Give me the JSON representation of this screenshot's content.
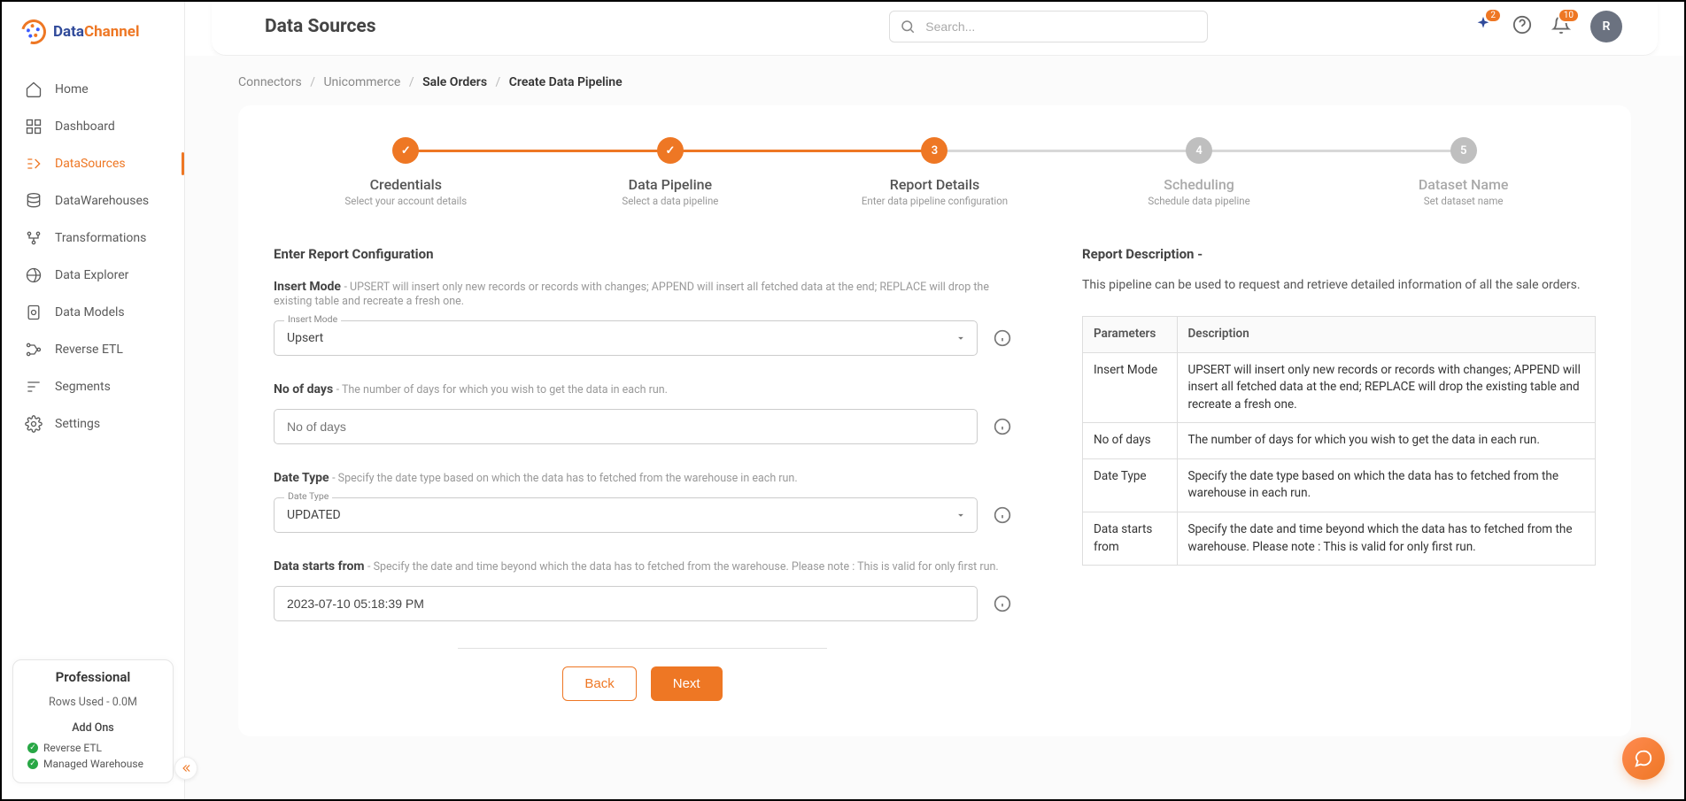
{
  "brand": {
    "part1": "Data",
    "part2": "Channel"
  },
  "sidebar": {
    "items": [
      {
        "label": "Home"
      },
      {
        "label": "Dashboard"
      },
      {
        "label": "DataSources"
      },
      {
        "label": "DataWarehouses"
      },
      {
        "label": "Transformations"
      },
      {
        "label": "Data Explorer"
      },
      {
        "label": "Data Models"
      },
      {
        "label": "Reverse ETL"
      },
      {
        "label": "Segments"
      },
      {
        "label": "Settings"
      }
    ],
    "plan": {
      "name": "Professional",
      "rows": "Rows Used - 0.0M",
      "addons_title": "Add Ons",
      "addons": [
        "Reverse ETL",
        "Managed Warehouse"
      ]
    }
  },
  "topbar": {
    "title": "Data Sources",
    "search_placeholder": "Search...",
    "spark_badge": "2",
    "bell_badge": "10",
    "avatar_initial": "R"
  },
  "breadcrumb": {
    "items": [
      "Connectors",
      "Unicommerce",
      "Sale Orders",
      "Create Data Pipeline"
    ]
  },
  "stepper": [
    {
      "title": "Credentials",
      "sub": "Select your account details",
      "state": "done",
      "mark": "✓"
    },
    {
      "title": "Data Pipeline",
      "sub": "Select a data pipeline",
      "state": "done",
      "mark": "✓"
    },
    {
      "title": "Report Details",
      "sub": "Enter data pipeline configuration",
      "state": "active",
      "mark": "3"
    },
    {
      "title": "Scheduling",
      "sub": "Schedule data pipeline",
      "state": "pending",
      "mark": "4"
    },
    {
      "title": "Dataset Name",
      "sub": "Set dataset name",
      "state": "pending",
      "mark": "5"
    }
  ],
  "form": {
    "section_title": "Enter Report Configuration",
    "fields": {
      "insert_mode": {
        "label": "Insert Mode",
        "help": "- UPSERT will insert only new records or records with changes; APPEND will insert all fetched data at the end; REPLACE will drop the existing table and recreate a fresh one.",
        "float": "Insert Mode",
        "value": "Upsert"
      },
      "no_of_days": {
        "label": "No of days",
        "help": "- The number of days for which you wish to get the data in each run.",
        "placeholder": "No of days",
        "value": ""
      },
      "date_type": {
        "label": "Date Type",
        "help": "- Specify the date type based on which the data has to fetched from the warehouse in each run.",
        "float": "Date Type",
        "value": "UPDATED"
      },
      "data_starts": {
        "label": "Data starts from",
        "help": "- Specify the date and time beyond which the data has to fetched from the warehouse. Please note : This is valid for only first run.",
        "value": "2023-07-10 05:18:39 PM"
      }
    }
  },
  "description": {
    "title": "Report Description -",
    "text": "This pipeline can be used to request and retrieve detailed information of all the sale orders.",
    "table": {
      "headers": [
        "Parameters",
        "Description"
      ],
      "rows": [
        [
          "Insert Mode",
          "UPSERT will insert only new records or records with changes; APPEND will insert all fetched data at the end; REPLACE will drop the existing table and recreate a fresh one."
        ],
        [
          "No of days",
          "The number of days for which you wish to get the data in each run."
        ],
        [
          "Date Type",
          "Specify the date type based on which the data has to fetched from the warehouse in each run."
        ],
        [
          "Data starts from",
          "Specify the date and time beyond which the data has to fetched from the warehouse. Please note : This is valid for only first run."
        ]
      ]
    }
  },
  "buttons": {
    "back": "Back",
    "next": "Next"
  }
}
